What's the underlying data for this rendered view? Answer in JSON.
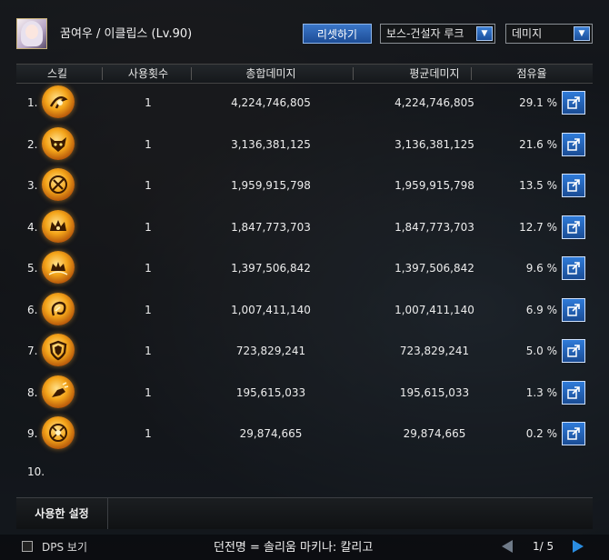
{
  "header": {
    "character_name": "꿈여우 / 이클립스 (Lv.90)",
    "reset_label": "리셋하기",
    "target_select": "보스-건설자 루크",
    "metric_select": "데미지"
  },
  "columns": {
    "skill": "스킬",
    "uses": "사용횟수",
    "total": "총합데미지",
    "avg": "평균데미지",
    "share": "점유율"
  },
  "rows": [
    {
      "index": "1.",
      "icon": "spiral-slash-icon",
      "uses": "1",
      "total": "4,224,746,805",
      "avg": "4,224,746,805",
      "share": "29.1 %"
    },
    {
      "index": "2.",
      "icon": "demon-mask-icon",
      "uses": "1",
      "total": "3,136,381,125",
      "avg": "3,136,381,125",
      "share": "21.6 %"
    },
    {
      "index": "3.",
      "icon": "crossed-slash-icon",
      "uses": "1",
      "total": "1,959,915,798",
      "avg": "1,959,915,798",
      "share": "13.5 %"
    },
    {
      "index": "4.",
      "icon": "crown-icon",
      "uses": "1",
      "total": "1,847,773,703",
      "avg": "1,847,773,703",
      "share": "12.7 %"
    },
    {
      "index": "5.",
      "icon": "crown-aura-icon",
      "uses": "1",
      "total": "1,397,506,842",
      "avg": "1,397,506,842",
      "share": "9.6 %"
    },
    {
      "index": "6.",
      "icon": "whip-spiral-icon",
      "uses": "1",
      "total": "1,007,411,140",
      "avg": "1,007,411,140",
      "share": "6.9 %"
    },
    {
      "index": "7.",
      "icon": "shield-icon",
      "uses": "1",
      "total": "723,829,241",
      "avg": "723,829,241",
      "share": "5.0 %"
    },
    {
      "index": "8.",
      "icon": "fist-strike-icon",
      "uses": "1",
      "total": "195,615,033",
      "avg": "195,615,033",
      "share": "1.3 %"
    },
    {
      "index": "9.",
      "icon": "rune-circle-icon",
      "uses": "1",
      "total": "29,874,665",
      "avg": "29,874,665",
      "share": "0.2 %"
    }
  ],
  "row10_index": "10.",
  "footer": {
    "used_settings": "사용한 설정"
  },
  "bottom": {
    "dps_label": "DPS 보기",
    "dungeon": "던전명 = 솔리움 마키나: 칼리고",
    "page": "1/ 5"
  },
  "colors": {
    "accent_blue": "#2f7bd8",
    "skill_gold": "#f4a51a"
  }
}
